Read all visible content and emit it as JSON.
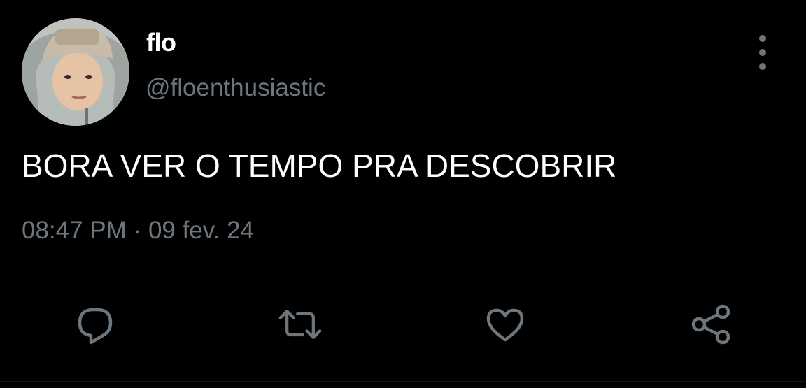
{
  "tweet": {
    "display_name": "flo",
    "handle": "@floenthusiastic",
    "text": "BORA VER O TEMPO PRA DESCOBRIR",
    "time": "08:47 PM",
    "separator": "·",
    "date": "09 fev. 24"
  },
  "icons": {
    "more": "more-vertical-icon",
    "reply": "reply-bubble-icon",
    "retweet": "retweet-icon",
    "like": "heart-icon",
    "share": "share-icon"
  },
  "colors": {
    "background": "#000000",
    "primary_text": "#ffffff",
    "secondary_text": "#6e767d",
    "divider": "#2f3336"
  }
}
